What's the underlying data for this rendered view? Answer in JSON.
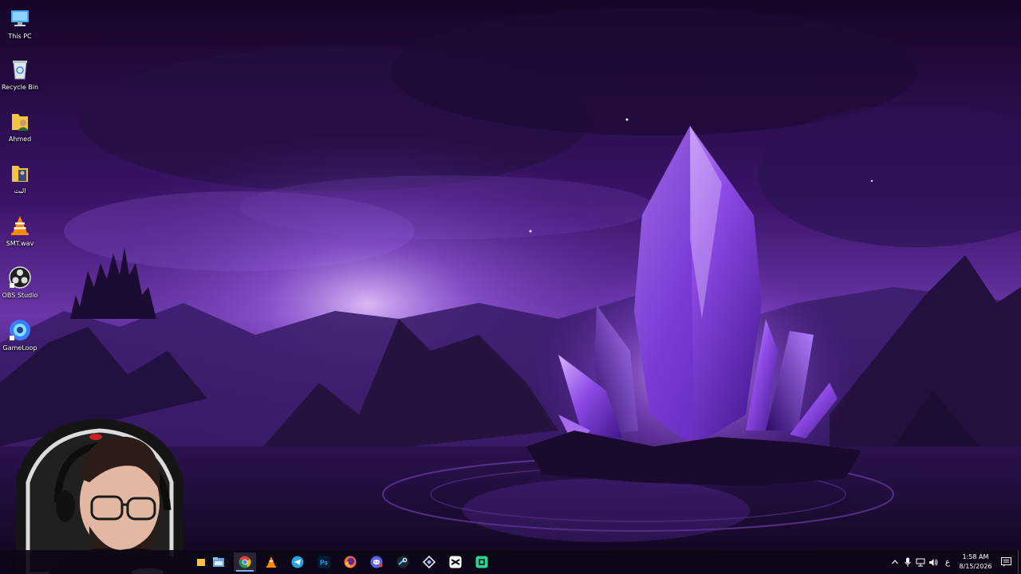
{
  "desktop": {
    "icons": [
      {
        "label": "This PC",
        "icon": "this-pc-icon"
      },
      {
        "label": "Recycle Bin",
        "icon": "recycle-bin-icon"
      },
      {
        "label": "Ahmed",
        "icon": "user-folder-icon"
      },
      {
        "label": "البث",
        "icon": "folder-icon"
      },
      {
        "label": "SMT.wav",
        "icon": "vlc-icon"
      },
      {
        "label": "OBS Studio",
        "icon": "obs-icon"
      },
      {
        "label": "GameLoop",
        "icon": "gameloop-icon"
      }
    ]
  },
  "taskbar": {
    "apps": [
      {
        "name": "File Explorer",
        "icon": "file-explorer-icon"
      },
      {
        "name": "Google Chrome",
        "icon": "chrome-icon",
        "active": true
      },
      {
        "name": "VLC media player",
        "icon": "vlc-icon"
      },
      {
        "name": "Telegram",
        "icon": "telegram-icon"
      },
      {
        "name": "Photoshop",
        "icon": "photoshop-icon"
      },
      {
        "name": "Firefox",
        "icon": "firefox-icon"
      },
      {
        "name": "Discord",
        "icon": "discord-icon"
      },
      {
        "name": "Steam",
        "icon": "steam-icon"
      },
      {
        "name": "App",
        "icon": "diamond-app-icon"
      },
      {
        "name": "CapCut",
        "icon": "capcut-icon"
      },
      {
        "name": "App",
        "icon": "green-app-icon"
      }
    ],
    "tray": {
      "language": "ع",
      "time": "1:58 AM",
      "date": "8/15/2026"
    }
  },
  "colors": {
    "wallpaper_sky": "#2a1050",
    "crystal": "#a15cff",
    "taskbar": "#0c0816",
    "accent": "#7fb2ff"
  }
}
